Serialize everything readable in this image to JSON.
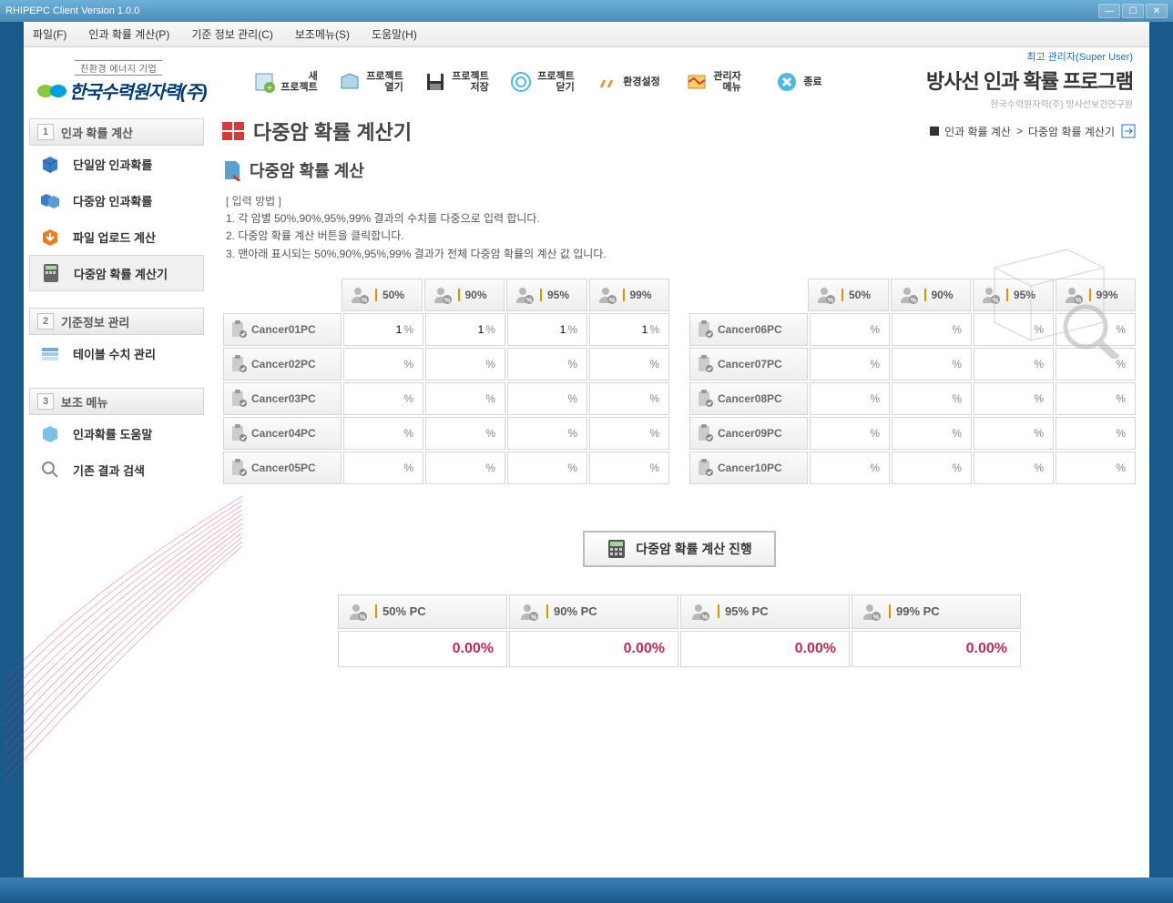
{
  "window": {
    "title": "RHIPEPC Client Version 1.0.0"
  },
  "menus": [
    "파일(F)",
    "인과 확률 계산(P)",
    "기준 정보 관리(C)",
    "보조메뉴(S)",
    "도움말(H)"
  ],
  "logo": {
    "tagline": "친환경 에너지 기업",
    "name": "한국수력원자력(주)"
  },
  "toolbar": [
    {
      "label": "새\n프로젝트"
    },
    {
      "label": "프로젝트\n열기"
    },
    {
      "label": "프로젝트\n저장"
    },
    {
      "label": "프로젝트\n닫기"
    },
    {
      "label": "환경설정"
    },
    {
      "label": "관리자\n메뉴"
    },
    {
      "label": "종료"
    }
  ],
  "header": {
    "super_user": "최고 관리자(Super User)",
    "app_title": "방사선 인과 확률 프로그램",
    "app_sub": "한국수력원자력(주) 방사선보건연구원"
  },
  "sidebar": {
    "sections": [
      {
        "num": "1",
        "title": "인과 확률 계산",
        "items": [
          "단일암 인과확률",
          "다중암 인과확률",
          "파일 업로드 계산",
          "다중암 확률 계산기"
        ],
        "selected": 3
      },
      {
        "num": "2",
        "title": "기준정보 관리",
        "items": [
          "테이블 수치 관리"
        ],
        "selected": -1
      },
      {
        "num": "3",
        "title": "보조 메뉴",
        "items": [
          "인과확률 도움말",
          "기존 결과 검색"
        ],
        "selected": -1
      }
    ]
  },
  "page": {
    "title": "다중암 확률 계산기",
    "breadcrumb1": "인과 확률 계산",
    "breadcrumb2": "다중암 확률 계산기",
    "panel_title": "다중암 확률 계산",
    "instr_head": "[ 입력 방법 ]",
    "instr1": "1. 각 암별 50%,90%,95%,99% 결과의 수치를 다중으로 입력 합니다.",
    "instr2": "2. 다중암 확률 계산 버튼을 클릭합니다.",
    "instr3": "3. 맨아래 표시되는 50%,90%,95%,99% 결과가 전체 다중암 확률의 계산 값 입니다.",
    "headers": [
      "50%",
      "90%",
      "95%",
      "99%"
    ],
    "rows_left": [
      "Cancer01PC",
      "Cancer02PC",
      "Cancer03PC",
      "Cancer04PC",
      "Cancer05PC"
    ],
    "rows_right": [
      "Cancer06PC",
      "Cancer07PC",
      "Cancer08PC",
      "Cancer09PC",
      "Cancer10PC"
    ],
    "values_left": [
      [
        "1",
        "1",
        "1",
        "1"
      ],
      [
        "",
        "",
        "",
        ""
      ],
      [
        "",
        "",
        "",
        ""
      ],
      [
        "",
        "",
        "",
        ""
      ],
      [
        "",
        "",
        "",
        ""
      ]
    ],
    "values_right": [
      [
        "",
        "",
        "",
        ""
      ],
      [
        "",
        "",
        "",
        ""
      ],
      [
        "",
        "",
        "",
        ""
      ],
      [
        "",
        "",
        "",
        ""
      ],
      [
        "",
        "",
        "",
        ""
      ]
    ],
    "unit": "%",
    "calc_button": "다중암 확률 계산 진행",
    "result_headers": [
      "50% PC",
      "90% PC",
      "95% PC",
      "99% PC"
    ],
    "result_values": [
      "0.00%",
      "0.00%",
      "0.00%",
      "0.00%"
    ]
  }
}
